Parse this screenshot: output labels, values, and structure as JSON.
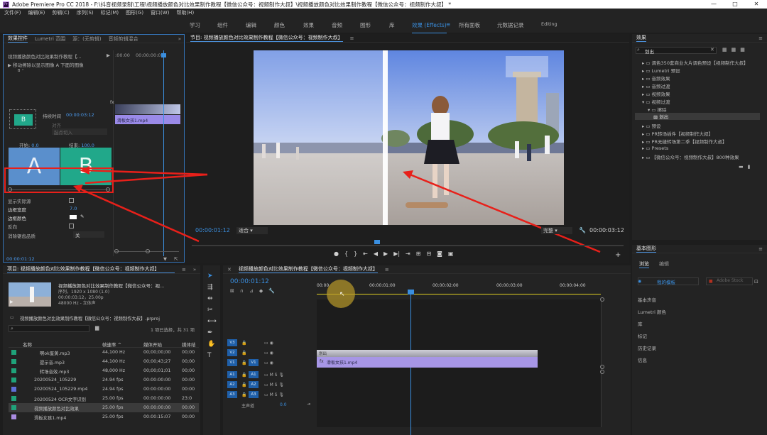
{
  "titlebar": {
    "logo": "Pr",
    "title": "Adobe Premiere Pro CC 2018 - F:\\抖音视频录制\\工程\\视频播放颜色对比效果制作教程【微信公众号：视频制作大叔】\\视频播放颜色对比效果制作教程【微信公众号：视频制作大叔】 *",
    "minimize": "—",
    "maximize": "□",
    "close": "✕"
  },
  "menu": [
    "文件(F)",
    "编辑(E)",
    "剪辑(C)",
    "序列(S)",
    "标记(M)",
    "图形(G)",
    "窗口(W)",
    "帮助(H)"
  ],
  "workspaces": [
    "学习",
    "组件",
    "编辑",
    "颜色",
    "效果",
    "音频",
    "图形",
    "库",
    "效果 (Effects)",
    "所有面板",
    "元数据记录",
    "Editing"
  ],
  "effect_controls": {
    "tabs": [
      "效果控件",
      "Lumetri 范围",
      "源：(无剪辑)",
      "音频剪辑混合"
    ],
    "clip_path": "视频播放颜色对比效果制作教程【...",
    "effect_name": "移动擦除以显示图像 A 下面的图像",
    "duration_label": "持续时间",
    "duration_value": "00:00:03:12",
    "align_label": "对齐",
    "align_value": "起点切入",
    "start_label": "开始:",
    "start_value": "0.0",
    "end_label": "结束:",
    "end_value": "100.0",
    "show_source_label": "显示实际源",
    "border_width_label": "边框宽度",
    "border_width_value": "7.0",
    "border_color_label": "边框颜色",
    "reverse_label": "反向",
    "antialias_label": "消除锯齿品质",
    "antialias_value": "关",
    "a_label": "A",
    "b_label": "B",
    "mini_time_start": ":00:00",
    "mini_time_mid": "00:00:00:00",
    "clip_label": "滑板女孩1.mp4",
    "footer_time": "00:00:01:12"
  },
  "program_monitor": {
    "title": "节目: 视频播放颜色对比效果制作教程【微信公众号：视频制作大叔】",
    "current_time": "00:00:01:12",
    "fit_label": "适合",
    "quality_label": "完整",
    "duration": "00:00:03:12"
  },
  "effects_panel": {
    "title": "效果",
    "search_value": "划出",
    "items": [
      {
        "label": "调色350套商业大片调色预设【视频制作大叔】",
        "indent": 0
      },
      {
        "label": "Lumetri 预设",
        "indent": 0
      },
      {
        "label": "音频效果",
        "indent": 0
      },
      {
        "label": "音频过渡",
        "indent": 0
      },
      {
        "label": "视频效果",
        "indent": 0
      },
      {
        "label": "视频过渡",
        "indent": 0
      },
      {
        "label": "擦除",
        "indent": 1
      },
      {
        "label": "划出",
        "indent": 2
      },
      {
        "label": "预设",
        "indent": 0
      },
      {
        "label": "PR转场插件【视频制作大叔】",
        "indent": 0
      },
      {
        "label": "PR无缝转场第二季【视频制作大叔】",
        "indent": 0
      },
      {
        "label": "Presets",
        "indent": 0
      },
      {
        "label": "【微信公众号：视频制作大叔】800种效果",
        "indent": 0
      }
    ]
  },
  "essential_graphics": {
    "title": "基本图形",
    "tabs": [
      "浏览",
      "编辑"
    ],
    "my_templates": "我的模板",
    "adobe_stock": "Adobe Stock",
    "items": [
      "基本声音",
      "Lumetri 颜色",
      "库",
      "标记",
      "历史记录",
      "信息"
    ]
  },
  "project": {
    "title": "项目: 视频播放颜色对比效果制作教程【微信公众号：视频制作大叔】",
    "seq_name": "视频播放颜色对比效果制作教程【微信公众号：视...",
    "seq_line1": "序列，1920 x 1080 (1.0)",
    "seq_line2": "00:00:03:12，25.00p",
    "seq_line3": "48000 Hz - 立体声",
    "proj_file": "视频播放颜色对比效果制作教程【微信公众号：视频制作大叔】.prproj",
    "selection": "1 项已选择，共 31 项",
    "col_name": "名称",
    "col_rate": "帧速率 ^",
    "col_start": "媒体开始",
    "col_end": "媒体结",
    "rows": [
      {
        "name": "啊ok蛋黄.mp3",
        "rate": "44,100 Hz",
        "start": "00;00;00;00",
        "end": "00;00",
        "color": "#1fa37a"
      },
      {
        "name": "提示音.mp3",
        "rate": "44,100 Hz",
        "start": "00;00;43;27",
        "end": "00;00",
        "color": "#1fa37a"
      },
      {
        "name": "转场音效.mp3",
        "rate": "48,000 Hz",
        "start": "00;00;01;01",
        "end": "00;00",
        "color": "#1fa37a"
      },
      {
        "name": "20200524_105229",
        "rate": "24.94 fps",
        "start": "00:00:00:00",
        "end": "00:00",
        "color": "#1fa37a"
      },
      {
        "name": "20200524_105229.mp4",
        "rate": "24.94 fps",
        "start": "00:00:00:00",
        "end": "00:00",
        "color": "#5f6fd8"
      },
      {
        "name": "20200524 OCR文字识别",
        "rate": "25.00 fps",
        "start": "00:00:00:00",
        "end": "23:0",
        "color": "#1fa37a"
      },
      {
        "name": "视频播放颜色对比效果",
        "rate": "25.00 fps",
        "start": "00:00:00:00",
        "end": "00:00",
        "color": "#1fa37a"
      },
      {
        "name": "滑板女孩1.mp4",
        "rate": "25.00 fps",
        "start": "00:00:15:07",
        "end": "00:00",
        "color": "#a98be0"
      }
    ]
  },
  "timeline": {
    "title": "视频播放颜色对比效果制作教程【微信公众号：视频制作大叔】",
    "current_time": "00:00:01:12",
    "ruler": [
      "00:00",
      "00:00:01:00",
      "00:00:02:00",
      "00:00:03:00",
      "00:00:04:00"
    ],
    "tracks": [
      "V3",
      "V2",
      "V1",
      "A1",
      "A2",
      "A3"
    ],
    "master": "主声道",
    "master_value": "0.0",
    "transition_label": "划出",
    "clip_label": "滑板女孩1.mp4"
  },
  "colors": {
    "accent_blue": "#3a8fe0",
    "annotation_red": "#e8201a",
    "clip_purple": "#a796e6"
  }
}
